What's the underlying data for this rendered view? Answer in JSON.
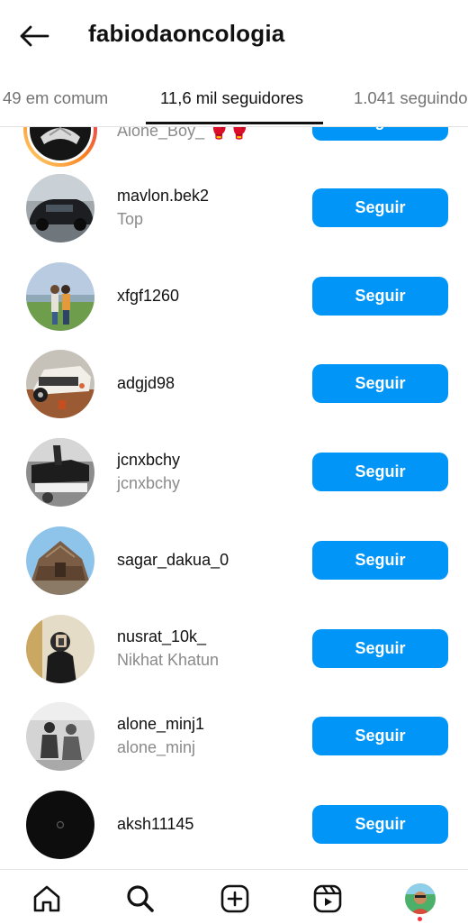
{
  "header": {
    "title": "fabiodaoncologia"
  },
  "tabs": [
    {
      "label": "49 em comum"
    },
    {
      "label": "11,6 mil seguidores"
    },
    {
      "label": "1.041 seguindo"
    }
  ],
  "follow_label": "Seguir",
  "followers": [
    {
      "username": "",
      "subtitle": "Alone_Boy_ 🥊🥊",
      "avatar": "dark-profile-with-story-ring-icon"
    },
    {
      "username": "mavlon.bek2",
      "subtitle": "Top",
      "avatar": "black-car-photo"
    },
    {
      "username": "xfgf1260",
      "subtitle": "",
      "avatar": "couple-in-field-photo"
    },
    {
      "username": "adgjd98",
      "subtitle": "",
      "avatar": "offroad-car-photo"
    },
    {
      "username": "jcnxbchy",
      "subtitle": "jcnxbchy",
      "avatar": "black-white-legs-photo"
    },
    {
      "username": "sagar_dakua_0",
      "subtitle": "",
      "avatar": "temple-photo"
    },
    {
      "username": "nusrat_10k_",
      "subtitle": "Nikhat Khatun",
      "avatar": "selfie-girl-photo"
    },
    {
      "username": "alone_minj1",
      "subtitle": "alone_minj",
      "avatar": "sketch-figures-photo"
    },
    {
      "username": "aksh11145",
      "subtitle": "",
      "avatar": "black-circle-avatar"
    }
  ],
  "nav": [
    {
      "icon": "home-icon"
    },
    {
      "icon": "search-icon"
    },
    {
      "icon": "create-post-icon"
    },
    {
      "icon": "reels-icon"
    },
    {
      "icon": "profile-avatar-icon"
    }
  ],
  "colors": {
    "accent": "#0095f6",
    "muted_text": "#8a8a8a",
    "notification": "#ff3040"
  }
}
